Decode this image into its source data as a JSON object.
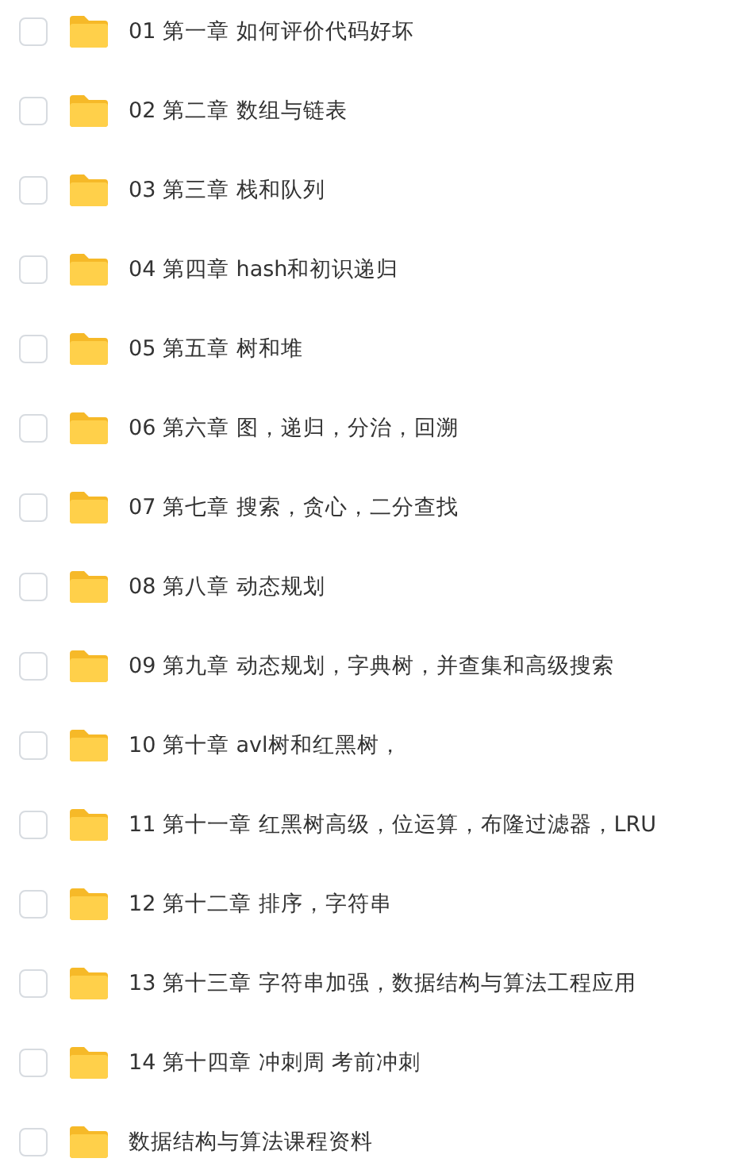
{
  "items": [
    {
      "name": "01 第一章 如何评价代码好坏",
      "checked": false
    },
    {
      "name": "02 第二章 数组与链表",
      "checked": false
    },
    {
      "name": "03 第三章 栈和队列",
      "checked": false
    },
    {
      "name": "04 第四章 hash和初识递归",
      "checked": false
    },
    {
      "name": "05 第五章 树和堆",
      "checked": false
    },
    {
      "name": "06 第六章 图，递归，分治，回溯",
      "checked": false
    },
    {
      "name": "07 第七章 搜索，贪心，二分查找",
      "checked": false
    },
    {
      "name": "08 第八章 动态规划",
      "checked": false
    },
    {
      "name": "09 第九章 动态规划，字典树，并查集和高级搜索",
      "checked": false
    },
    {
      "name": "10 第十章 avl树和红黑树，",
      "checked": false
    },
    {
      "name": "11 第十一章 红黑树高级，位运算，布隆过滤器，LRU",
      "checked": false
    },
    {
      "name": "12 第十二章 排序，字符串",
      "checked": false
    },
    {
      "name": "13 第十三章 字符串加强，数据结构与算法工程应用",
      "checked": false
    },
    {
      "name": "14 第十四章 冲刺周 考前冲刺",
      "checked": false
    },
    {
      "name": "数据结构与算法课程资料",
      "checked": false
    }
  ]
}
